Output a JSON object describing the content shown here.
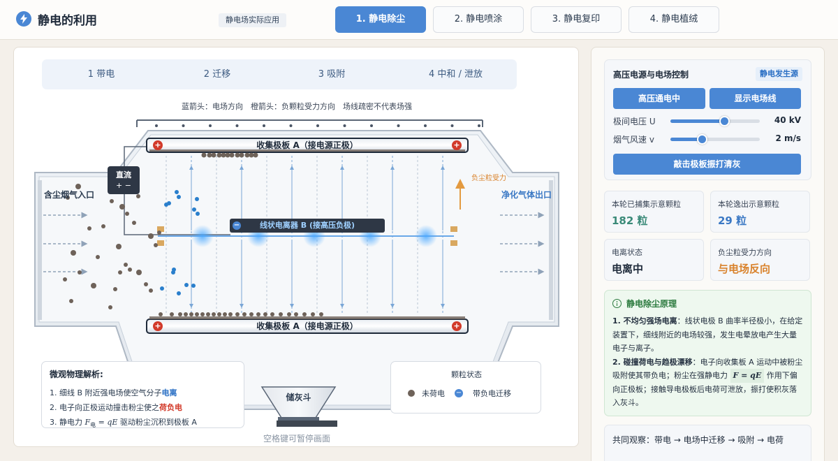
{
  "header": {
    "title": "静电的利用",
    "subtitle": "静电场实际应用",
    "tabs": [
      {
        "label": "1. 静电除尘",
        "active": true
      },
      {
        "label": "2. 静电喷涂",
        "active": false
      },
      {
        "label": "3. 静电复印",
        "active": false
      },
      {
        "label": "4. 静电植绒",
        "active": false
      }
    ]
  },
  "simulation": {
    "steps": [
      "1 带电",
      "2 迁移",
      "3 吸附",
      "4 中和 / 泄放"
    ],
    "legend_note": "蓝箭头：电场方向　橙箭头：负颗粒受力方向　场线疏密不代表场强",
    "top_plate_label": "收集极板 A（接电源正极）",
    "bottom_plate_label": "收集极板 A（接电源正极）",
    "wire_label": "线状电离器 B (接高压负极)",
    "dc_label": "直流",
    "dc_polarity": "+ −",
    "inlet_label": "含尘烟气入口",
    "outlet_label": "净化气体出口",
    "force_label": "负尘粒受力",
    "hopper_label": "储灰斗",
    "plus_sign": "+",
    "minus_sign": "−",
    "micro": {
      "title": "微观物理解析:",
      "line1_prefix": "1. 细线 B 附近强电场使空气分子",
      "line1_highlight": "电离",
      "line2_prefix": "2. 电子向正极运动撞击粉尘使之",
      "line2_highlight": "荷负电",
      "line3_prefix": "3. 静电力 ",
      "line3_formula_F": "F",
      "line3_formula_sub": "电",
      "line3_formula_rest": " = qE",
      "line3_suffix": " 驱动粉尘沉积到极板 A"
    },
    "particle_state": {
      "title": "颗粒状态",
      "uncharged": "未荷电",
      "charged": "带负电迁移"
    },
    "pause_hint": "空格键可暂停画面"
  },
  "control": {
    "title": "高压电源与电场控制",
    "tag": "静电发生源",
    "power_button": "高压通电中",
    "field_button": "显示电场线",
    "voltage_label": "极间电压 U",
    "voltage_value": "40 kV",
    "voltage_fraction": 0.6,
    "speed_label": "烟气风速 v",
    "speed_value": "2 m/s",
    "speed_fraction": 0.35,
    "rap_button": "敲击极板振打清灰"
  },
  "stats": {
    "captured_label": "本轮已捕集示意颗粒",
    "captured_value": "182 粒",
    "escaped_label": "本轮逸出示意颗粒",
    "escaped_value": "29 粒",
    "ion_label": "电离状态",
    "ion_value": "电离中",
    "force_dir_label": "负尘粒受力方向",
    "force_dir_value": "与电场反向"
  },
  "principle": {
    "title": "静电除尘原理",
    "p1_bold": "1. 不均匀强场电离",
    "p1_text": "：线状电极 B 曲率半径极小，在给定装置下，细线附近的电场较强，发生电晕放电产生大量电子与离子。",
    "p2_bold": "2. 碰撞荷电与趋极漂移",
    "p2_text_a": "：电子向收集板 A 运动中被粉尘吸附使其带负电；粉尘在强静电力 ",
    "p2_formula": "F = qE",
    "p2_text_b": " 作用下偏向正极板；接触导电极板后电荷可泄放，振打使积灰落入灰斗。"
  },
  "observe": "共同观察：带电 → 电场中迁移 → 吸附 → 电荷",
  "colors": {
    "accent": "#4a87d4",
    "captured": "#3a8a78",
    "escaped": "#3a78c4",
    "force": "#d9822b",
    "particle": "#6e6259",
    "charged": "#2a7fcc"
  }
}
